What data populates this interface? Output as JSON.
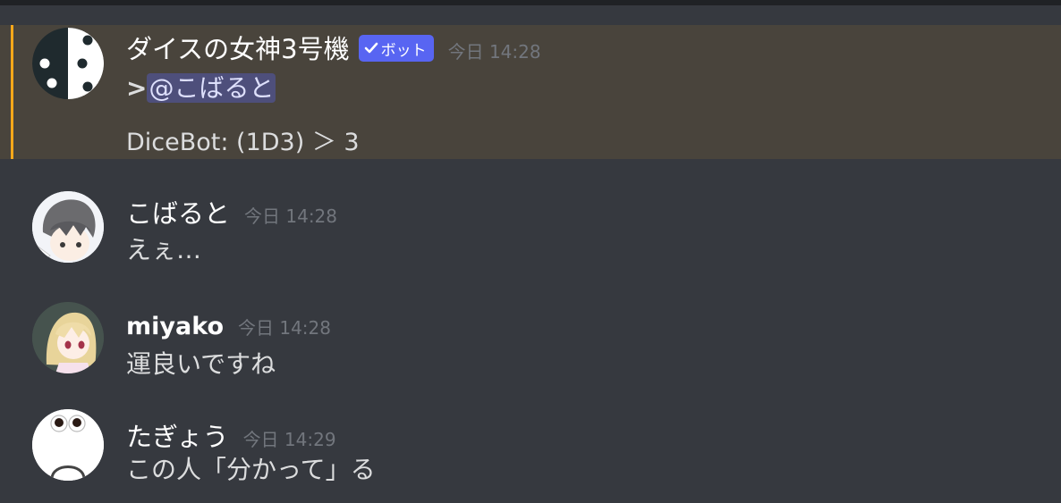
{
  "messages": [
    {
      "username": "ダイスの女神3号機",
      "bot_tag": "ボット",
      "timestamp": "今日 14:28",
      "reply_prefix": ">",
      "mention": "@こばると",
      "lines": [
        "DiceBot: (1D3) ＞ 3"
      ],
      "highlighted": true,
      "accent_color": "#faa81a"
    },
    {
      "username": "こばると",
      "timestamp": "今日 14:28",
      "lines": [
        "えぇ…"
      ]
    },
    {
      "username": "miyako",
      "timestamp": "今日 14:28",
      "lines": [
        "運良いですね"
      ]
    },
    {
      "username": "たぎょう",
      "timestamp": "今日 14:29",
      "lines": [
        "この人「分かって」る"
      ]
    }
  ],
  "colors": {
    "background": "#36393f",
    "mention_highlight": "#49443c",
    "bot_tag": "#5865f2",
    "timestamp": "#72767d"
  },
  "icons": [
    "dice-avatar-icon",
    "check-icon"
  ]
}
